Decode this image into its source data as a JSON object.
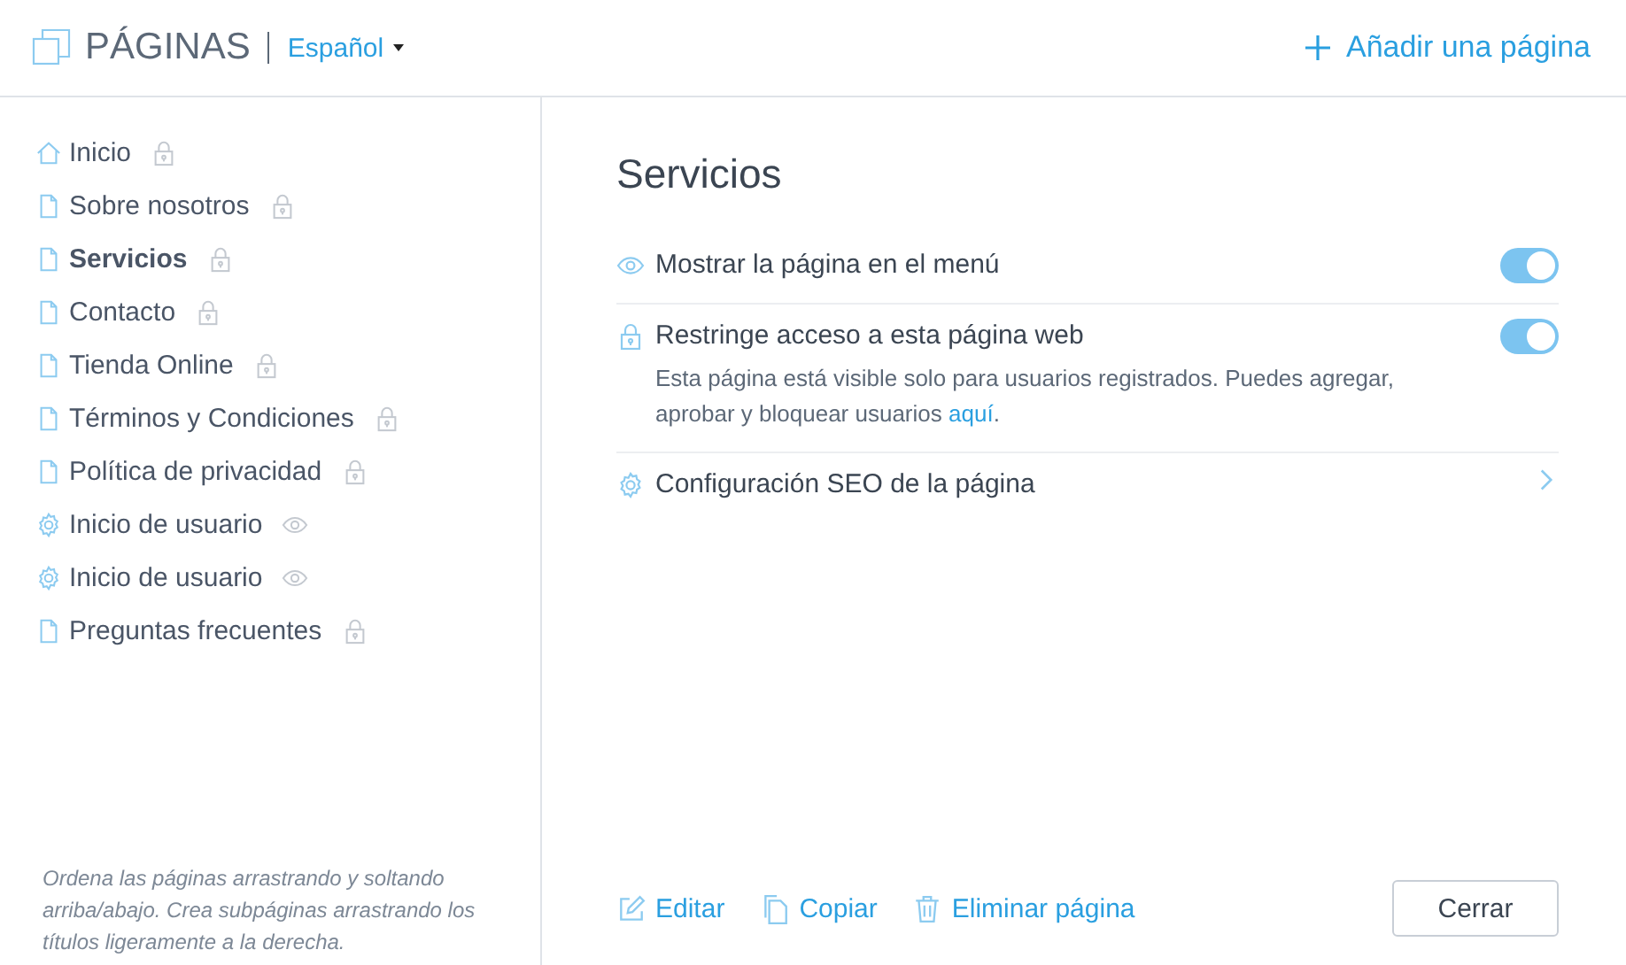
{
  "header": {
    "title": "PÁGINAS",
    "language": "Español",
    "add_button": "Añadir una página"
  },
  "sidebar": {
    "items": [
      {
        "label": "Inicio",
        "kind": "home",
        "locked": true,
        "hidden": false,
        "selected": false
      },
      {
        "label": "Sobre nosotros",
        "kind": "page",
        "locked": true,
        "hidden": false,
        "selected": false
      },
      {
        "label": "Servicios",
        "kind": "page",
        "locked": true,
        "hidden": false,
        "selected": true
      },
      {
        "label": "Contacto",
        "kind": "page",
        "locked": true,
        "hidden": false,
        "selected": false
      },
      {
        "label": "Tienda Online",
        "kind": "page",
        "locked": true,
        "hidden": false,
        "selected": false
      },
      {
        "label": "Términos y Condiciones",
        "kind": "page",
        "locked": true,
        "hidden": false,
        "selected": false
      },
      {
        "label": "Política de privacidad",
        "kind": "page",
        "locked": true,
        "hidden": false,
        "selected": false
      },
      {
        "label": "Inicio de usuario",
        "kind": "system",
        "locked": false,
        "hidden": true,
        "selected": false
      },
      {
        "label": "Inicio de usuario",
        "kind": "system",
        "locked": false,
        "hidden": true,
        "selected": false
      },
      {
        "label": "Preguntas frecuentes",
        "kind": "page",
        "locked": true,
        "hidden": false,
        "selected": false
      }
    ],
    "hint": "Ordena las páginas arrastrando y soltando arriba/abajo. Crea subpáginas arrastrando los títulos ligeramente a la derecha."
  },
  "main": {
    "title": "Servicios",
    "settings": [
      {
        "kind": "toggle",
        "label": "Mostrar la página en el menú",
        "on": true
      },
      {
        "kind": "toggle",
        "label": "Restringe acceso a esta página web",
        "on": true,
        "description": {
          "text": "Esta página está visible solo para usuarios registrados. Puedes agregar, aprobar y bloquear usuarios ",
          "link": "aquí",
          "after": "."
        }
      },
      {
        "kind": "link",
        "label": "Configuración SEO de la página"
      }
    ],
    "actions": [
      "Editar",
      "Copiar",
      "Eliminar página"
    ],
    "close_button": "Cerrar"
  }
}
